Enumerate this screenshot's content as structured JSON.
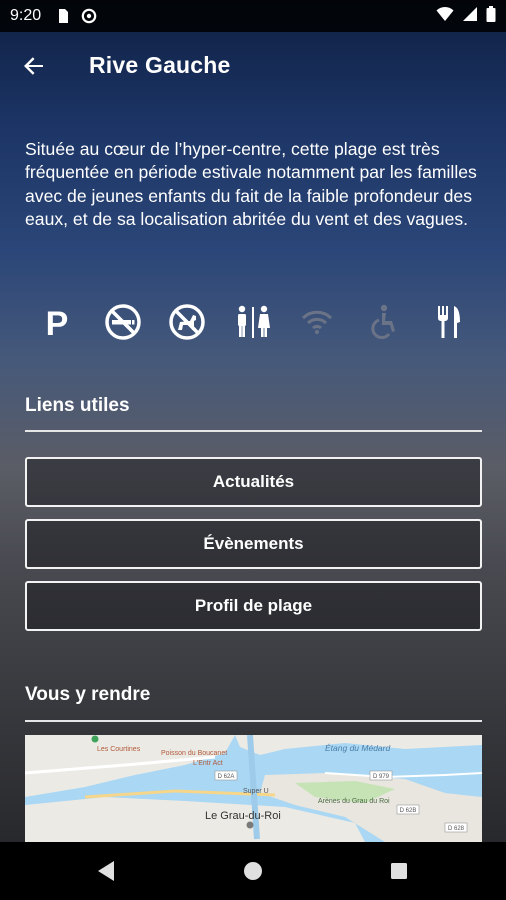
{
  "status_bar": {
    "time": "9:20",
    "icons": [
      "sd-card-icon",
      "data-saver-icon",
      "wifi-icon",
      "cellular-signal-icon",
      "battery-icon"
    ]
  },
  "app_bar": {
    "title": "Rive Gauche",
    "back_icon": "arrow-left-icon"
  },
  "description": "Située au cœur de l’hyper-centre, cette plage est très fréquentée en période estivale notamment par les familles avec de jeunes enfants du fait de la faible profondeur des eaux, et de sa localisation abritée du vent et des vagues.",
  "amenities": [
    {
      "icon": "parking-icon",
      "active": true
    },
    {
      "icon": "no-smoking-icon",
      "active": true
    },
    {
      "icon": "no-dogs-icon",
      "active": true
    },
    {
      "icon": "toilets-icon",
      "active": true
    },
    {
      "icon": "wifi-icon",
      "active": false
    },
    {
      "icon": "accessibility-icon",
      "active": false
    },
    {
      "icon": "restaurant-icon",
      "active": true
    }
  ],
  "links_section": {
    "title": "Liens utiles",
    "buttons": [
      "Actualités",
      "Évènements",
      "Profil de plage"
    ]
  },
  "directions_section": {
    "title": "Vous y rendre"
  },
  "map": {
    "labels": {
      "town": "Le Grau-du-Roi",
      "pond": "Étang du Médard",
      "arenes": "Arènes du Grau du Roi",
      "poisson": "Poisson du Boucanet",
      "courtines": "Les Courtines",
      "entre": "L'Entr Act",
      "super": "Super U",
      "road1": "D 62A",
      "road2": "D 979",
      "road3": "D 62B",
      "road4": "D 628"
    }
  },
  "nav_bar": {
    "icons": [
      "back-triangle-icon",
      "home-circle-icon",
      "recents-square-icon"
    ]
  },
  "colors": {
    "background_top": "#0f2042",
    "background_bottom": "#202124",
    "text": "#ffffff",
    "inactive_icon": "#6b7387",
    "button_border": "#f2f2f2"
  }
}
